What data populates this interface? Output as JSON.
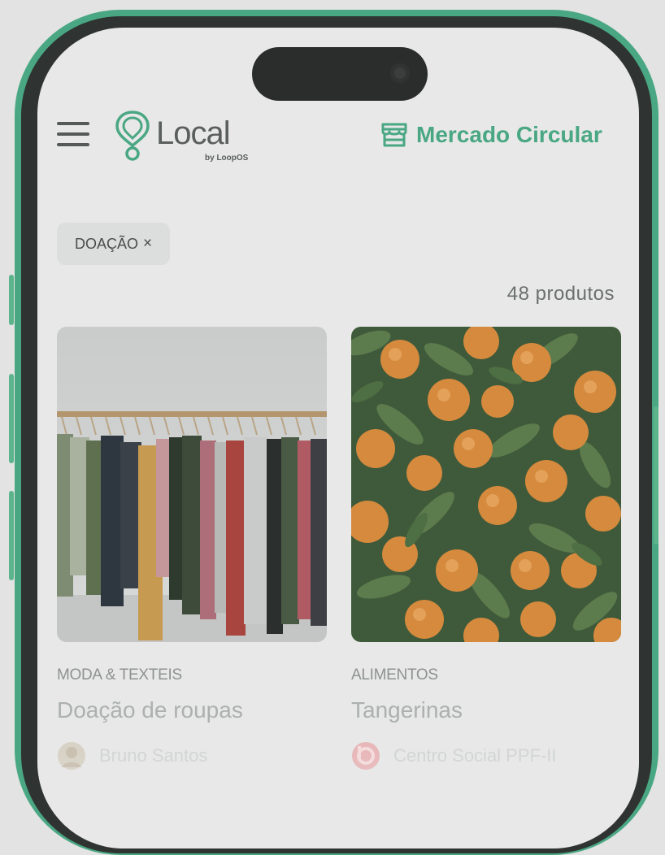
{
  "header": {
    "logo_text": "Local",
    "logo_subtext": "by LoopOS",
    "market_label": "Mercado Circular"
  },
  "filter": {
    "chip_label": "DOAÇÃO",
    "chip_remove": "×"
  },
  "results": {
    "count_label": "48 produtos"
  },
  "products": [
    {
      "category": "MODA & TEXTEIS",
      "title": "Doação de roupas",
      "seller": "Bruno Santos"
    },
    {
      "category": "ALIMENTOS",
      "title": "Tangerinas",
      "seller": "Centro Social PPF-II"
    }
  ],
  "icons": {
    "menu": "hamburger-menu-icon",
    "logo": "location-pin-logo",
    "market": "storefront-icon",
    "seller1": "avatar-icon",
    "seller2": "beats-logo-icon"
  },
  "colors": {
    "accent": "#4aa783",
    "background": "#e7e8e7",
    "text_dark": "#484c4a",
    "text_muted": "#8e9290"
  }
}
